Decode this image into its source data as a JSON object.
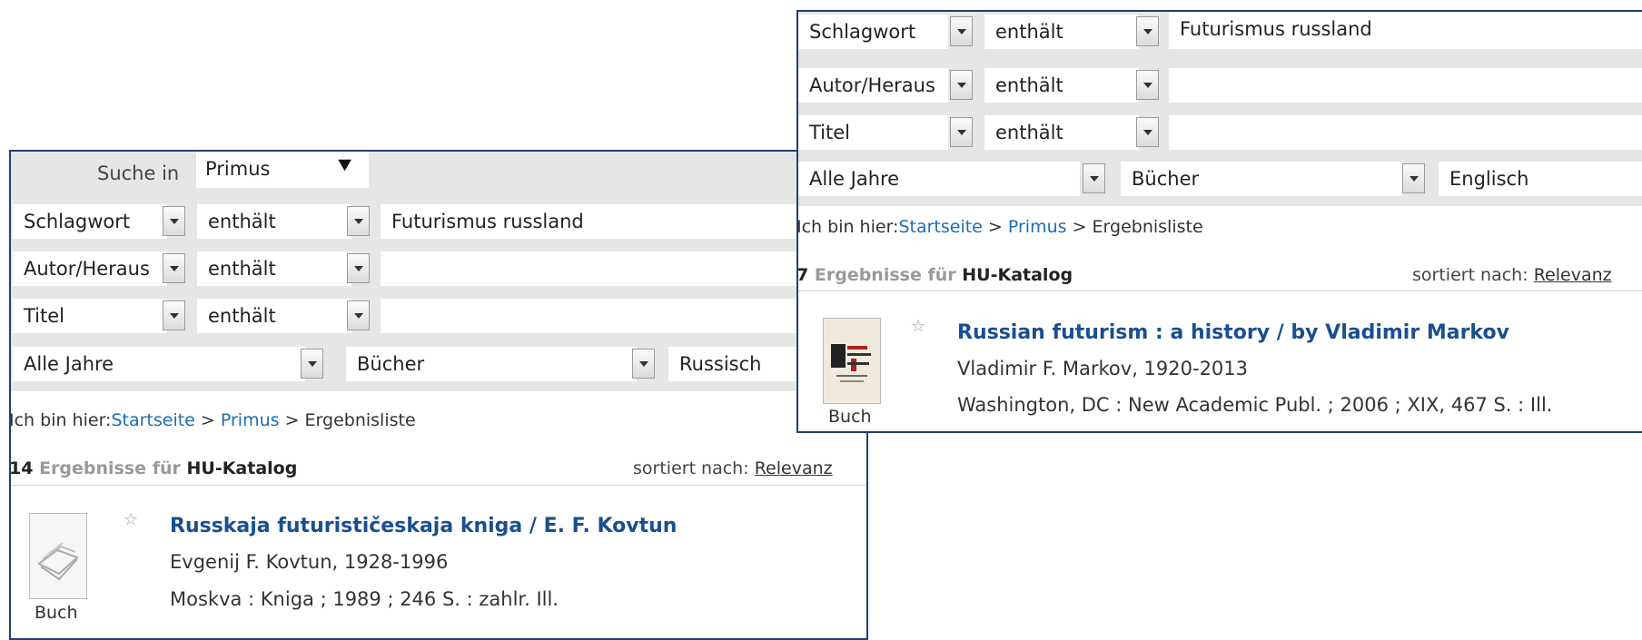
{
  "left": {
    "search_in_label": "Suche in",
    "search_in_value": "Primus",
    "rows": [
      {
        "field": "Schlagwort",
        "op": "enthält",
        "value": "Futurismus russland"
      },
      {
        "field": "Autor/Heraus",
        "op": "enthält",
        "value": ""
      },
      {
        "field": "Titel",
        "op": "enthält",
        "value": ""
      }
    ],
    "filters": {
      "year": "Alle Jahre",
      "type": "Bücher",
      "lang": "Russisch"
    },
    "breadcrumb": {
      "prefix": "Ich bin hier:",
      "home": "Startseite",
      "sep": " > ",
      "mid": "Primus",
      "current": "Ergebnisliste"
    },
    "count": "14",
    "count_label": "Ergebnisse",
    "for_label": "für",
    "catalog": "HU-Katalog",
    "sort_label": "sortiert nach:",
    "sort_value": "Relevanz",
    "result": {
      "title": "Russkaja futurističeskaja kniga / E. F. Kovtun",
      "author": "Evgenij F. Kovtun, 1928-1996",
      "imprint": "Moskva : Kniga ; 1989 ; 246 S. : zahlr. Ill.",
      "format": "Buch"
    }
  },
  "right": {
    "rows": [
      {
        "field": "Schlagwort",
        "op": "enthält",
        "value": "Futurismus russland"
      },
      {
        "field": "Autor/Heraus",
        "op": "enthält",
        "value": ""
      },
      {
        "field": "Titel",
        "op": "enthält",
        "value": ""
      }
    ],
    "filters": {
      "year": "Alle Jahre",
      "type": "Bücher",
      "lang": "Englisch"
    },
    "breadcrumb": {
      "prefix": "Ich bin hier:",
      "home": "Startseite",
      "sep": " > ",
      "mid": "Primus",
      "current": "Ergebnisliste"
    },
    "count": "7",
    "count_label": "Ergebnisse",
    "for_label": "für",
    "catalog": "HU-Katalog",
    "sort_label": "sortiert nach:",
    "sort_value": "Relevanz",
    "result": {
      "title": "Russian futurism : a history / by Vladimir Markov",
      "author": "Vladimir F. Markov, 1920-2013",
      "imprint": "Washington, DC : New Academic Publ. ; 2006 ; XIX, 467 S. : Ill.",
      "format": "Buch"
    }
  },
  "icons": {
    "star": "star-outline-icon",
    "expand": "double-chevron-down-icon",
    "dropdown": "dropdown-arrow-icon"
  }
}
